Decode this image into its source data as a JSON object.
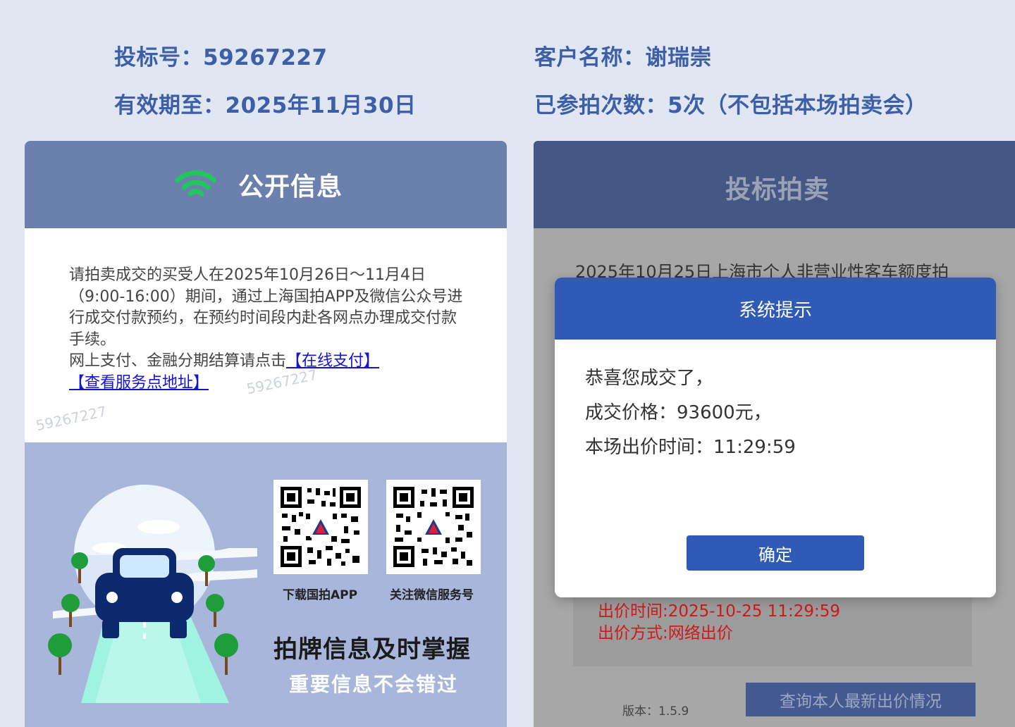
{
  "header": {
    "bid_number": "投标号：59267227",
    "customer_name": "客户名称：谢瑞崇",
    "valid_until": "有效期至：2025年11月30日",
    "participation_count": "已参拍次数：5次（不包括本场拍卖会）"
  },
  "left_panel": {
    "title": "公开信息",
    "icon": "wifi-icon",
    "notice_text": "请拍卖成交的买受人在2025年10月26日～11月4日（9:00-16:00）期间，通过上海国拍APP及微信公众号进行成交付款预约，在预约时间段内赴各网点办理成交付款手续。",
    "notice_text2": "网上支付、金融分期结算请点击",
    "online_pay_link": "【在线支付】",
    "service_location_link": "【查看服务点地址】",
    "watermark": "59267227",
    "promo": {
      "qr1_caption": "下载国拍APP",
      "qr2_caption": "关注微信服务号",
      "title": "拍牌信息及时掌握",
      "subtitle": "重要信息不会错过"
    }
  },
  "right_panel": {
    "title": "投标拍卖",
    "auction_name": "2025年10月25日上海市个人非营业性客车额度拍",
    "bid_time": "出价时间:2025-10-25 11:29:59",
    "bid_method": "出价方式:网络出价",
    "version": "版本：1.5.9",
    "query_button": "查询本人最新出价情况"
  },
  "modal": {
    "title": "系统提示",
    "line1": "恭喜您成交了，",
    "line2": "成交价格：93600元，",
    "line3": "本场出价时间：11:29:59",
    "ok_button": "确定"
  },
  "colors": {
    "accent_blue": "#2f5bb6",
    "header_text": "#3d5fa8",
    "bid_red": "#d01818"
  }
}
